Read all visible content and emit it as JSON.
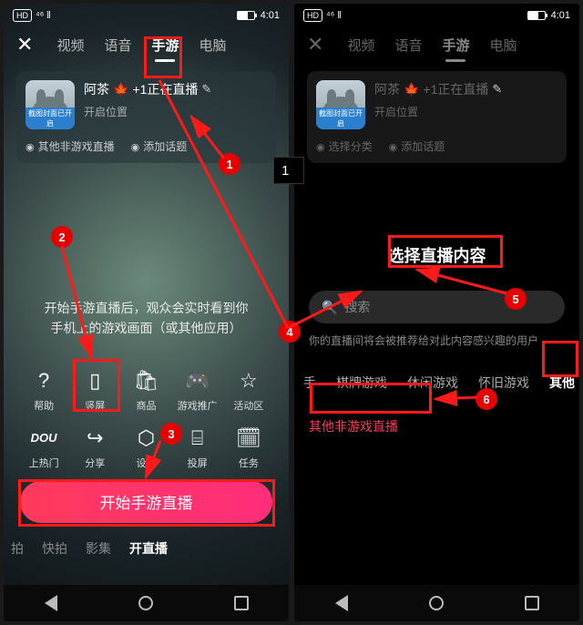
{
  "status": {
    "hd": "HD",
    "sig": "46",
    "signal": "ᴴ",
    "time": "4:01"
  },
  "tabs": {
    "video": "视频",
    "voice": "语音",
    "mobile_game": "手游",
    "pc": "电脑"
  },
  "card": {
    "thumb_label": "截图封面已开启",
    "user": "阿茶",
    "plus_live": "+1正在直播",
    "start_pos": "开启位置",
    "other_nongame": "其他非游戏直播",
    "add_topic": "添加话题",
    "select_category": "选择分类"
  },
  "instructions_l1": "开始手游直播后，观众会实时看到你",
  "instructions_l2": "手机上的游戏画面（或其他应用）",
  "icons": {
    "help": "帮助",
    "portrait": "竖屏",
    "goods": "商品",
    "game_rec": "游戏推广",
    "activity": "活动区",
    "dou": "DOU",
    "hot": "上热门",
    "share": "分享",
    "settings": "设置",
    "cast": "投屏",
    "task": "任务"
  },
  "start_button": "开始手游直播",
  "bottom_tabs": {
    "shoot": "拍",
    "quick": "快拍",
    "movie": "影集",
    "live": "开直播"
  },
  "modal": {
    "title": "选择直播内容",
    "search": "搜索",
    "hint": "你的直播间将会被推荐给对此内容感兴趣的用户",
    "cat_board": "棋牌游戏",
    "cat_casual": "休闲游戏",
    "cat_retro": "怀旧游戏",
    "cat_other": "其他",
    "item_other": "其他非游戏直播"
  },
  "editor_input": "1",
  "badges": {
    "b1": "1",
    "b2": "2",
    "b3": "3",
    "b4": "4",
    "b5": "5",
    "b6": "6"
  }
}
